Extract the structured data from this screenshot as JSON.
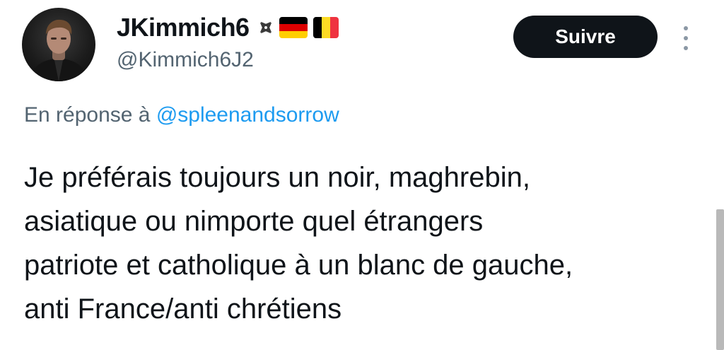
{
  "author": {
    "display_name": "JKimmich6",
    "handle": "@Kimmich6J2",
    "badges": [
      "maltese-cross-icon",
      "germany-flag-icon",
      "belgium-flag-icon"
    ]
  },
  "follow_button": {
    "label": "Suivre"
  },
  "more_menu": {
    "icon": "more-vertical-icon"
  },
  "reply": {
    "prefix": "En réponse à",
    "mention": "@spleenandsorrow"
  },
  "tweet_text_lines": [
    "Je préférais toujours un noir, maghrebin,",
    "asiatique ou nimporte quel étrangers",
    "patriote et catholique à un blanc de gauche,",
    "anti France/anti chrétiens"
  ],
  "colors": {
    "text": "#0f1419",
    "secondary": "#536471",
    "link": "#1d9bf0",
    "button_bg": "#0f1419",
    "button_text": "#ffffff"
  }
}
